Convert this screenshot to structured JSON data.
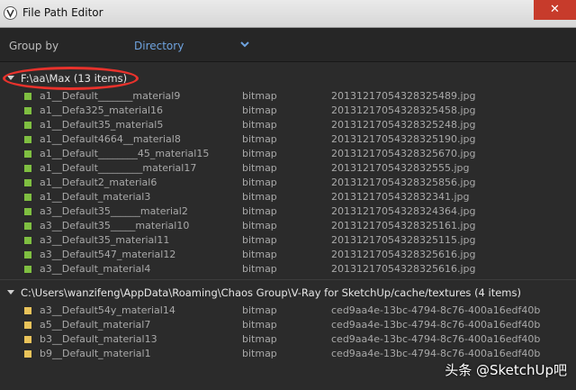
{
  "window": {
    "title": "File Path Editor",
    "close_glyph": "✕"
  },
  "toolbar": {
    "group_by_label": "Group by",
    "group_by_value": "Directory"
  },
  "colors": {
    "green": "#7fbf41",
    "yellow": "#e9c35a",
    "accent": "#6fa3df",
    "annotation": "#e8322c"
  },
  "groups": [
    {
      "title": "F:\\aa\\Max (13 items)",
      "items": [
        {
          "name": "a1__Default_______material9",
          "type": "bitmap",
          "file": "20131217054328325489.jpg"
        },
        {
          "name": "a1__Defa325_material16",
          "type": "bitmap",
          "file": "20131217054328325458.jpg"
        },
        {
          "name": "a1__Default35_material5",
          "type": "bitmap",
          "file": "20131217054328325248.jpg"
        },
        {
          "name": "a1__Default4664__material8",
          "type": "bitmap",
          "file": "20131217054328325190.jpg"
        },
        {
          "name": "a1__Default________45_material15",
          "type": "bitmap",
          "file": "20131217054328325670.jpg"
        },
        {
          "name": "a1__Default_________material17",
          "type": "bitmap",
          "file": "2013121705432832555.jpg"
        },
        {
          "name": "a1__Default2_material6",
          "type": "bitmap",
          "file": "20131217054328325856.jpg"
        },
        {
          "name": "a1__Default_material3",
          "type": "bitmap",
          "file": "2013121705432832341.jpg"
        },
        {
          "name": "a3__Default35______material2",
          "type": "bitmap",
          "file": "20131217054328324364.jpg"
        },
        {
          "name": "a3__Default35_____material10",
          "type": "bitmap",
          "file": "20131217054328325161.jpg"
        },
        {
          "name": "a3__Default35_material11",
          "type": "bitmap",
          "file": "20131217054328325115.jpg"
        },
        {
          "name": "a3__Default547_material12",
          "type": "bitmap",
          "file": "20131217054328325616.jpg"
        },
        {
          "name": "a3__Default_material4",
          "type": "bitmap",
          "file": "20131217054328325616.jpg"
        }
      ]
    },
    {
      "title": "C:\\Users\\wanzifeng\\AppData\\Roaming\\Chaos Group\\V-Ray for SketchUp/cache/textures (4 items)",
      "items": [
        {
          "name": "a3__Default54y_material14",
          "type": "bitmap",
          "file": "ced9aa4e-13bc-4794-8c76-400a16edf40b"
        },
        {
          "name": "a5__Default_material7",
          "type": "bitmap",
          "file": "ced9aa4e-13bc-4794-8c76-400a16edf40b"
        },
        {
          "name": "b3__Default_material13",
          "type": "bitmap",
          "file": "ced9aa4e-13bc-4794-8c76-400a16edf40b"
        },
        {
          "name": "b9__Default_material1",
          "type": "bitmap",
          "file": "ced9aa4e-13bc-4794-8c76-400a16edf40b"
        }
      ]
    }
  ],
  "watermark": "头条 @SketchUp吧"
}
